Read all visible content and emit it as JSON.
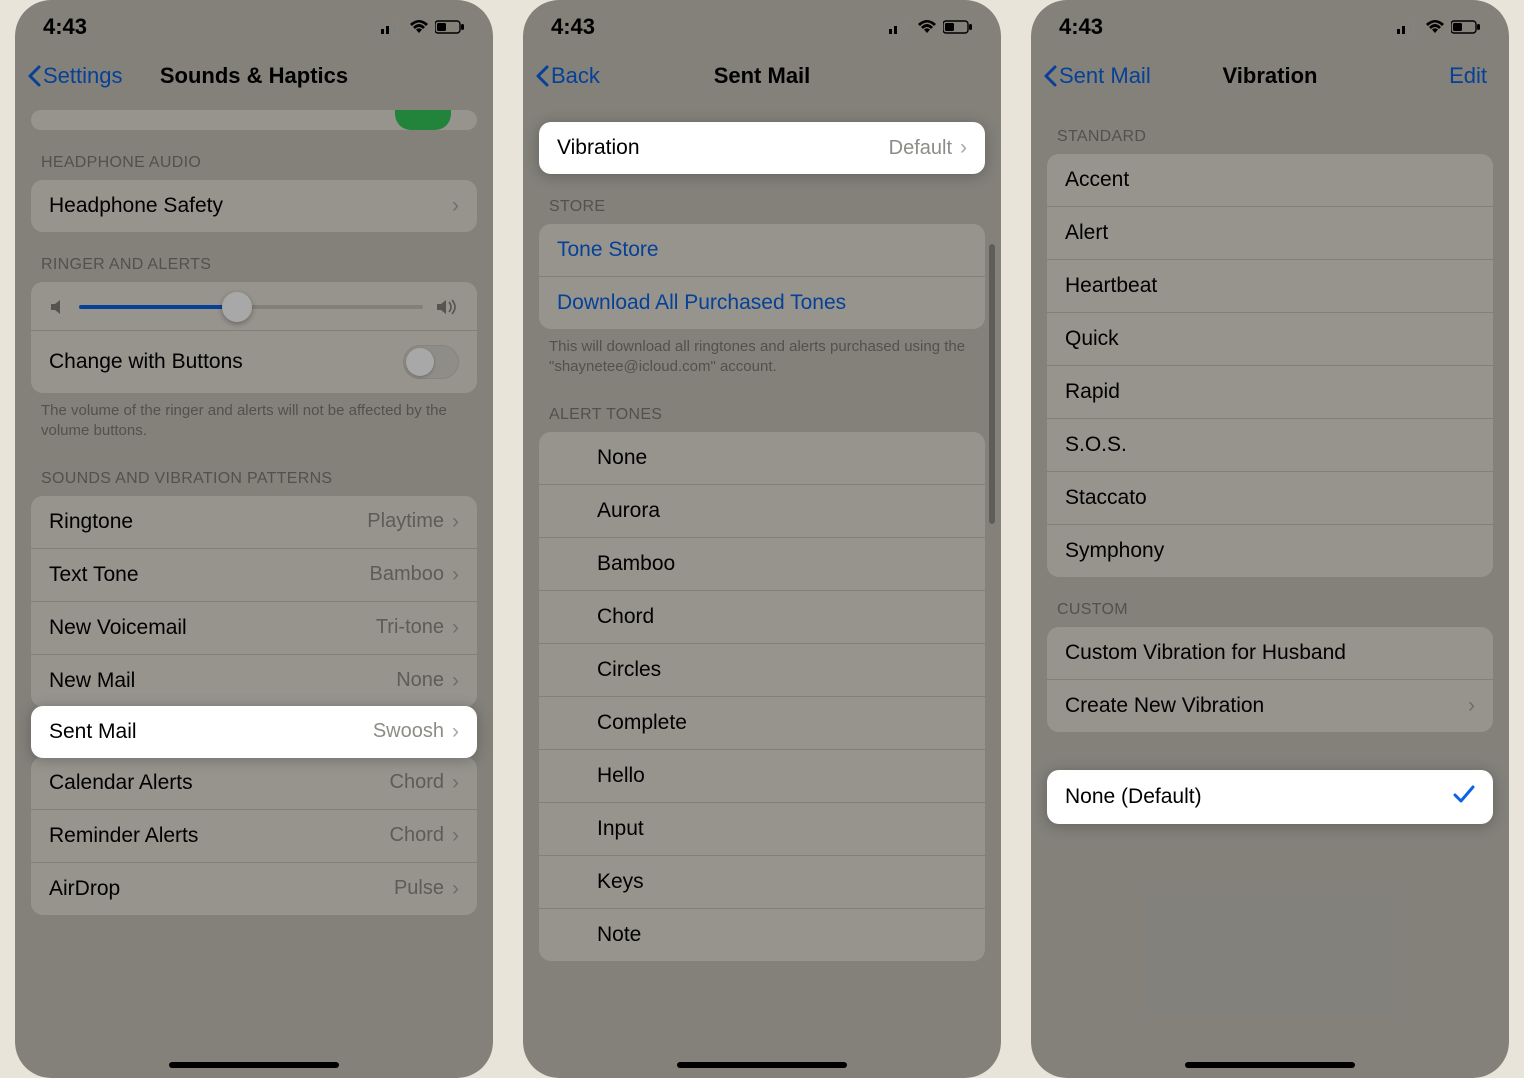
{
  "status": {
    "time": "4:43"
  },
  "p1": {
    "back": "Settings",
    "title": "Sounds & Haptics",
    "sec_headphone": "HEADPHONE AUDIO",
    "headphone_safety": "Headphone Safety",
    "sec_ringer": "RINGER AND ALERTS",
    "change_buttons": "Change with Buttons",
    "ringer_note": "The volume of the ringer and alerts will not be affected by the volume buttons.",
    "sec_patterns": "SOUNDS AND VIBRATION PATTERNS",
    "rows": {
      "ringtone": {
        "l": "Ringtone",
        "v": "Playtime"
      },
      "text": {
        "l": "Text Tone",
        "v": "Bamboo"
      },
      "voicemail": {
        "l": "New Voicemail",
        "v": "Tri-tone"
      },
      "newmail": {
        "l": "New Mail",
        "v": "None"
      },
      "sentmail": {
        "l": "Sent Mail",
        "v": "Swoosh"
      },
      "calendar": {
        "l": "Calendar Alerts",
        "v": "Chord"
      },
      "reminder": {
        "l": "Reminder Alerts",
        "v": "Chord"
      },
      "airdrop": {
        "l": "AirDrop",
        "v": "Pulse"
      }
    }
  },
  "p2": {
    "back": "Back",
    "title": "Sent Mail",
    "vibration": {
      "l": "Vibration",
      "v": "Default"
    },
    "sec_store": "STORE",
    "tone_store": "Tone Store",
    "download_all": "Download All Purchased Tones",
    "download_note": "This will download all ringtones and alerts purchased using the \"shaynetee@icloud.com\" account.",
    "sec_alert": "ALERT TONES",
    "tones": [
      "None",
      "Aurora",
      "Bamboo",
      "Chord",
      "Circles",
      "Complete",
      "Hello",
      "Input",
      "Keys",
      "Note"
    ]
  },
  "p3": {
    "back": "Sent Mail",
    "title": "Vibration",
    "edit": "Edit",
    "sec_standard": "STANDARD",
    "standard": [
      "Accent",
      "Alert",
      "Heartbeat",
      "Quick",
      "Rapid",
      "S.O.S.",
      "Staccato",
      "Symphony"
    ],
    "sec_custom": "CUSTOM",
    "custom1": "Custom Vibration for Husband",
    "create": "Create New Vibration",
    "none_default": "None (Default)"
  }
}
